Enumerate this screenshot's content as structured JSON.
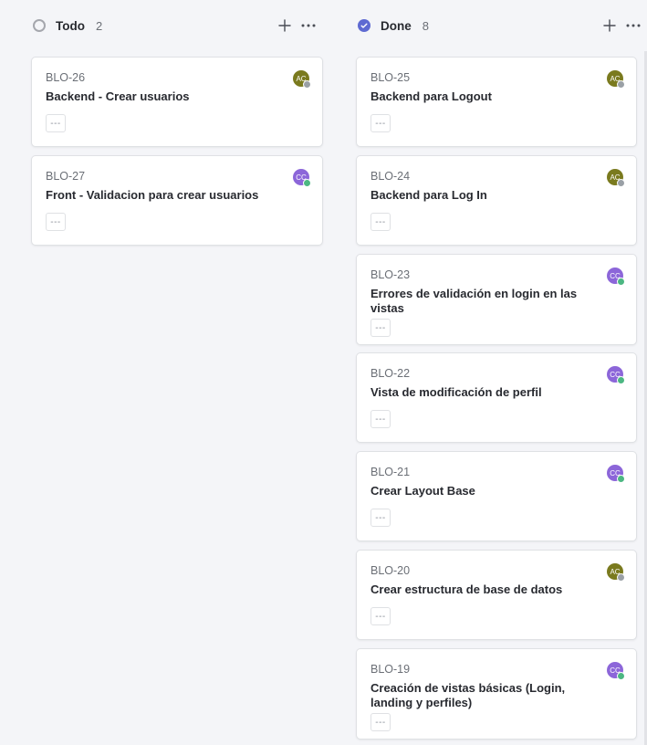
{
  "columns": [
    {
      "title": "Todo",
      "count": "2",
      "status": "todo",
      "cards": [
        {
          "id": "BLO-26",
          "title": "Backend - Crear usuarios",
          "assignee": "AC",
          "assignee_color": "#7a7a1e",
          "presence_color": "#9aa0a6",
          "action": "---"
        },
        {
          "id": "BLO-27",
          "title": "Front - Validacion para crear usuarios",
          "assignee": "CC",
          "assignee_color": "#8c66d9",
          "presence_color": "#4cb782",
          "action": "---"
        }
      ]
    },
    {
      "title": "Done",
      "count": "8",
      "status": "done",
      "cards": [
        {
          "id": "BLO-25",
          "title": "Backend para Logout",
          "assignee": "AC",
          "assignee_color": "#7a7a1e",
          "presence_color": "#9aa0a6",
          "action": "---"
        },
        {
          "id": "BLO-24",
          "title": "Backend para Log In",
          "assignee": "AC",
          "assignee_color": "#7a7a1e",
          "presence_color": "#9aa0a6",
          "action": "---"
        },
        {
          "id": "BLO-23",
          "title_lines": [
            "Errores de validación en login en las",
            "vistas"
          ],
          "assignee": "CC",
          "assignee_color": "#8c66d9",
          "presence_color": "#4cb782",
          "action": "---"
        },
        {
          "id": "BLO-22",
          "title": "Vista de modificación de perfil",
          "assignee": "CC",
          "assignee_color": "#8c66d9",
          "presence_color": "#4cb782",
          "action": "---"
        },
        {
          "id": "BLO-21",
          "title": "Crear Layout Base",
          "assignee": "CC",
          "assignee_color": "#8c66d9",
          "presence_color": "#4cb782",
          "action": "---"
        },
        {
          "id": "BLO-20",
          "title": "Crear estructura de base de datos",
          "assignee": "AC",
          "assignee_color": "#7a7a1e",
          "presence_color": "#9aa0a6",
          "action": "---"
        },
        {
          "id": "BLO-19",
          "title_lines": [
            "Creación de vistas básicas (Login,",
            "landing y perfiles)"
          ],
          "assignee": "CC",
          "assignee_color": "#8c66d9",
          "presence_color": "#4cb782",
          "action": "---"
        }
      ]
    }
  ],
  "icons": {
    "status_todo": "circle-empty-icon",
    "status_done": "circle-check-icon",
    "add": "plus-icon",
    "more": "ellipsis-icon"
  },
  "colors": {
    "accent": "#5e6ad2",
    "background": "#f4f5f8",
    "card": "#ffffff",
    "border": "#dfe1e4"
  }
}
